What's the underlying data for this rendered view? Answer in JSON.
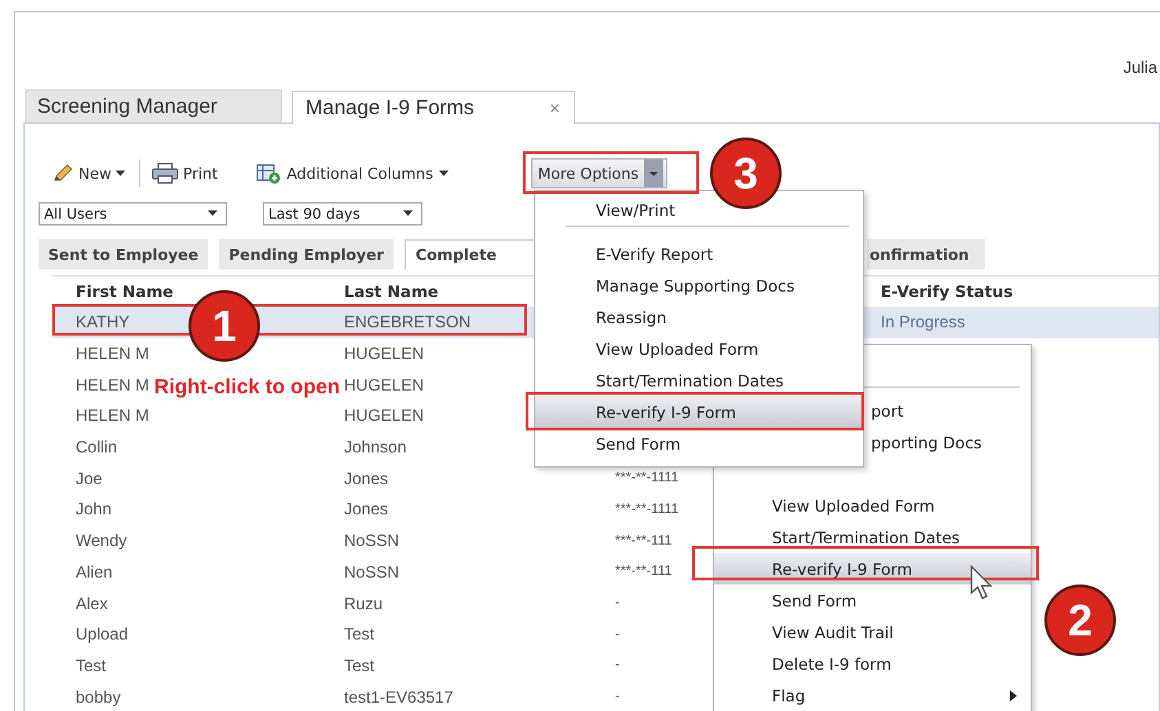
{
  "header": {
    "user": "Julia"
  },
  "tabs": [
    {
      "label": "Screening Manager",
      "selected": false
    },
    {
      "label": "Manage I-9 Forms",
      "selected": true,
      "close": "×"
    }
  ],
  "toolbar": [
    {
      "kind": "new",
      "label": "New",
      "dropdown": true
    },
    {
      "kind": "print",
      "label": "Print",
      "dropdown": false
    },
    {
      "kind": "columns",
      "label": "Additional Columns",
      "dropdown": true
    },
    {
      "kind": "more",
      "label": "More Options",
      "dropdown": true
    }
  ],
  "filters": [
    {
      "value": "All Users"
    },
    {
      "value": "Last 90 days"
    }
  ],
  "subtabs": [
    {
      "label": "Sent to Employee",
      "selected": false
    },
    {
      "label": "Pending Employer",
      "selected": false
    },
    {
      "label": "Complete",
      "selected": true
    },
    {
      "label": "onfirmation",
      "selected": false
    }
  ],
  "table": {
    "columns": [
      {
        "label": "First Name"
      },
      {
        "label": "Last Name"
      },
      {
        "label": "E-Verify Status"
      }
    ],
    "rows": [
      {
        "first": "KATHY",
        "last": "ENGEBRETSON",
        "status": "In Progress",
        "selected": true
      },
      {
        "first": "HELEN M",
        "last": "HUGELEN",
        "selected": false
      },
      {
        "first": "HELEN M",
        "last": "HUGELEN",
        "selected": false
      },
      {
        "first": "HELEN M",
        "last": "HUGELEN",
        "selected": false
      },
      {
        "first": "Collin",
        "last": "Johnson",
        "selected": false
      },
      {
        "first": "Joe",
        "last": "Jones",
        "column_3": "***-**-1111",
        "selected": false
      },
      {
        "first": "John",
        "last": "Jones",
        "column_3": "***-**-1111",
        "selected": false
      },
      {
        "first": "Wendy",
        "last": "NoSSN",
        "column_3": "***-**-111",
        "selected": false
      },
      {
        "first": "Alien",
        "last": "NoSSN",
        "column_3": "***-**-111",
        "selected": false
      },
      {
        "first": "Alex",
        "last": "Ruzu",
        "column_3": "-",
        "selected": false
      },
      {
        "first": "Upload",
        "last": "Test",
        "column_3": "-",
        "selected": false
      },
      {
        "first": "Test",
        "last": "Test",
        "column_3": "-",
        "selected": false
      },
      {
        "first": "bobby",
        "last": "test1-EV63517",
        "column_3": "-",
        "selected": false
      }
    ]
  },
  "more_options_menu": {
    "items": [
      {
        "label": "View/Print",
        "selected": false
      },
      {
        "label": "E-Verify Report",
        "selected": false
      },
      {
        "label": "Manage Supporting Docs",
        "selected": false
      },
      {
        "label": "Reassign",
        "selected": false
      },
      {
        "label": "View Uploaded Form",
        "selected": false
      },
      {
        "label": "Start/Termination Dates",
        "selected": false
      },
      {
        "label": "Re-verify I-9 Form",
        "selected": true
      },
      {
        "label": "Send Form",
        "selected": false
      }
    ]
  },
  "context_menu": {
    "items": [
      {
        "kind": "partial",
        "label": "port",
        "selected": false,
        "submenu": false
      },
      {
        "kind": "partial",
        "label": "pporting Docs",
        "selected": false,
        "submenu": false
      },
      {
        "kind": "item",
        "label": "View Uploaded Form",
        "selected": false,
        "submenu": false
      },
      {
        "kind": "item",
        "label": "Start/Termination Dates",
        "selected": false,
        "submenu": false
      },
      {
        "kind": "item",
        "label": "Re-verify I-9 Form",
        "selected": true,
        "submenu": false
      },
      {
        "kind": "item",
        "label": "Send Form",
        "selected": false,
        "submenu": false
      },
      {
        "kind": "item",
        "label": "View Audit Trail",
        "selected": false,
        "submenu": false
      },
      {
        "kind": "item",
        "label": "Delete I-9 form",
        "selected": false,
        "submenu": false
      },
      {
        "kind": "item",
        "label": "Flag",
        "selected": false,
        "submenu": true
      }
    ]
  },
  "annotation": {
    "text": "Right-click to open"
  },
  "callouts": [
    {
      "number": "1"
    },
    {
      "number": "2"
    },
    {
      "number": "3"
    }
  ]
}
